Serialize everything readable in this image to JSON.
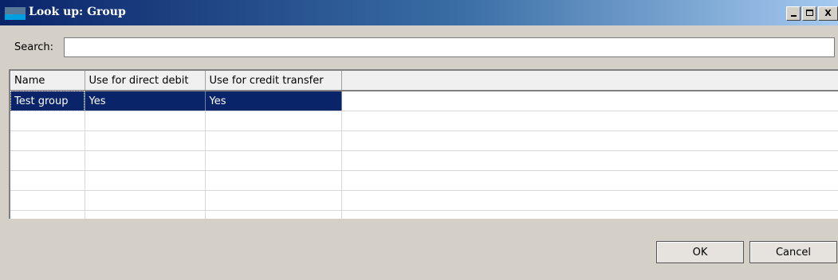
{
  "window": {
    "title": "Look up: Group",
    "minimize_label": "_",
    "close_label": "X"
  },
  "search": {
    "label": "Search:",
    "value": "",
    "placeholder": ""
  },
  "grid": {
    "columns": [
      "Name",
      "Use for direct debit",
      "Use for credit transfer"
    ],
    "rows": [
      {
        "name": "Test group",
        "direct_debit": "Yes",
        "credit_transfer": "Yes",
        "selected": true
      }
    ]
  },
  "buttons": {
    "ok": "OK",
    "cancel": "Cancel"
  },
  "colors": {
    "selection": "#0a246a",
    "title_gradient_start": "#0a246a",
    "title_gradient_end": "#a6caf0",
    "dialog_background": "#d4d0c8"
  },
  "icons": [
    "app-icon",
    "minimize-icon",
    "maximize-icon",
    "close-icon"
  ]
}
